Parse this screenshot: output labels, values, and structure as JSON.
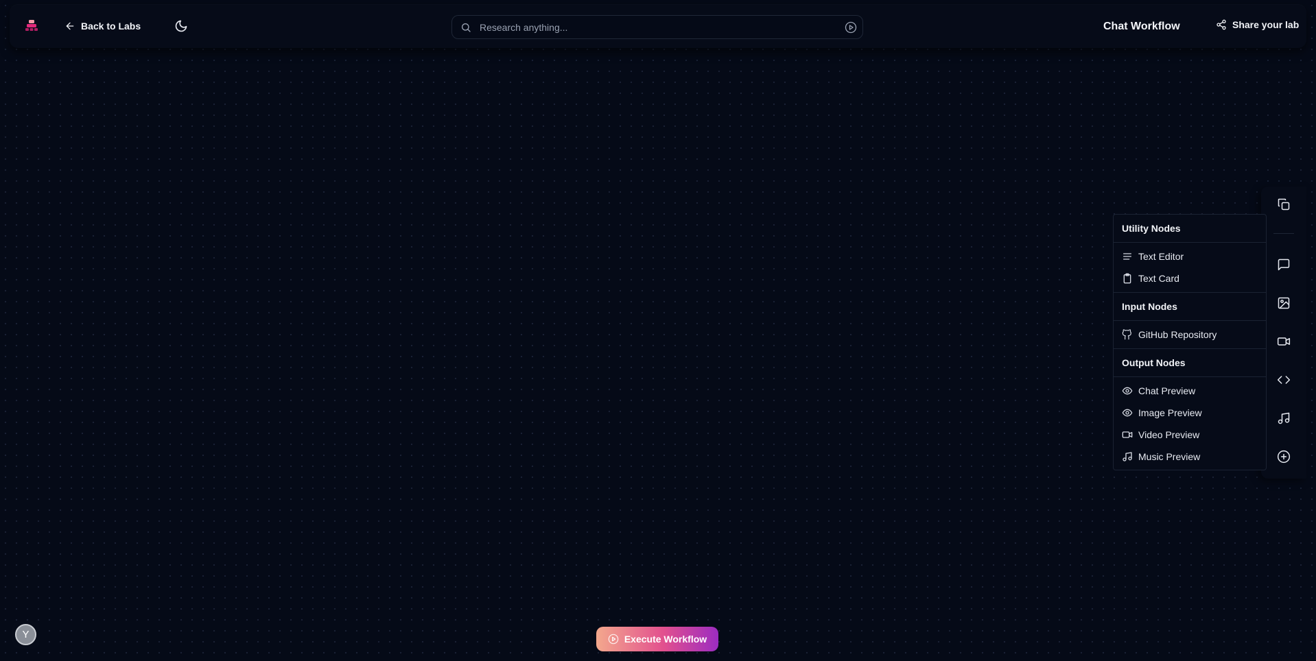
{
  "header": {
    "back_label": "Back to Labs",
    "search_placeholder": "Research anything...",
    "title": "Chat Workflow",
    "share_label": "Share your lab"
  },
  "rail": {
    "icons": [
      "copy-icon",
      "message-square-icon",
      "image-icon",
      "video-icon",
      "code-icon",
      "music-icon",
      "plus-circle-icon"
    ]
  },
  "panel": {
    "sections": [
      {
        "heading": "Utility Nodes",
        "items": [
          {
            "label": "Text Editor",
            "icon": "align-left-icon"
          },
          {
            "label": "Text Card",
            "icon": "clipboard-icon"
          }
        ]
      },
      {
        "heading": "Input Nodes",
        "items": [
          {
            "label": "GitHub Repository",
            "icon": "github-icon"
          }
        ]
      },
      {
        "heading": "Output Nodes",
        "items": [
          {
            "label": "Chat Preview",
            "icon": "eye-icon"
          },
          {
            "label": "Image Preview",
            "icon": "eye-icon"
          },
          {
            "label": "Video Preview",
            "icon": "video-icon"
          },
          {
            "label": "Music Preview",
            "icon": "music-icon"
          }
        ]
      }
    ]
  },
  "execute_label": "Execute Workflow",
  "user": {
    "avatar_initial": "Y"
  },
  "colors": {
    "background": "#050a17",
    "surface": "#060b18",
    "border": "#1b2333",
    "logo_pink": "#e2297a",
    "gradient_start": "#f3a88d",
    "gradient_mid": "#e2508e",
    "gradient_end": "#9c2cc1"
  }
}
